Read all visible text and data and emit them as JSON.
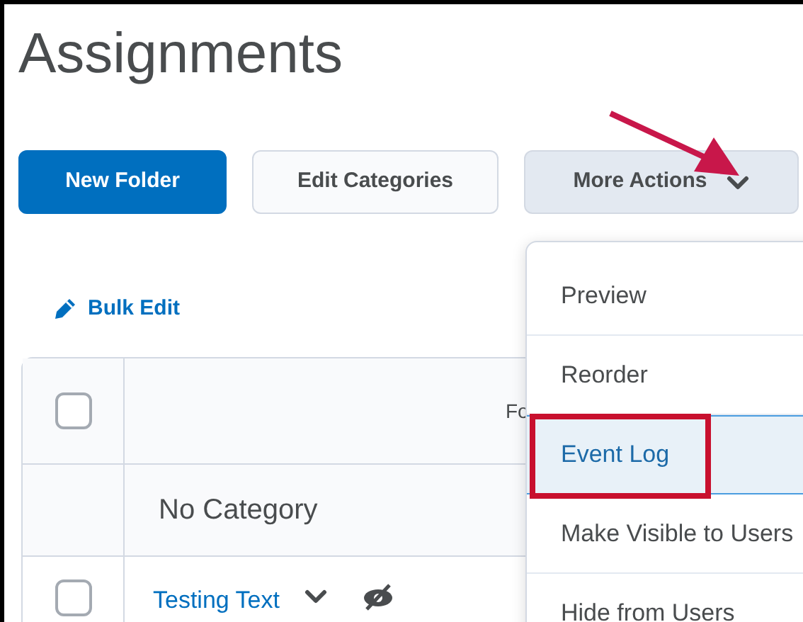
{
  "title": "Assignments",
  "toolbar": [
    {
      "kind": "primary",
      "label": "New Folder"
    },
    {
      "kind": "secondary",
      "label": "Edit Categories"
    },
    {
      "kind": "dropdown",
      "label": "More Actions",
      "expanded": true
    }
  ],
  "bulk_edit": {
    "label": "Bulk Edit"
  },
  "table": {
    "header": {
      "checked": false,
      "text": "Fo"
    },
    "rows": [
      {
        "kind": "category",
        "label": "No Category"
      },
      {
        "kind": "item",
        "label": "Testing Text",
        "checked": false,
        "hidden": true
      }
    ]
  },
  "menu": [
    {
      "label": "Preview",
      "selected": false
    },
    {
      "label": "Reorder",
      "selected": false
    },
    {
      "label": "Event Log",
      "selected": true
    },
    {
      "label": "Make Visible to Users",
      "selected": false
    },
    {
      "label": "Hide from Users",
      "selected": false
    }
  ]
}
